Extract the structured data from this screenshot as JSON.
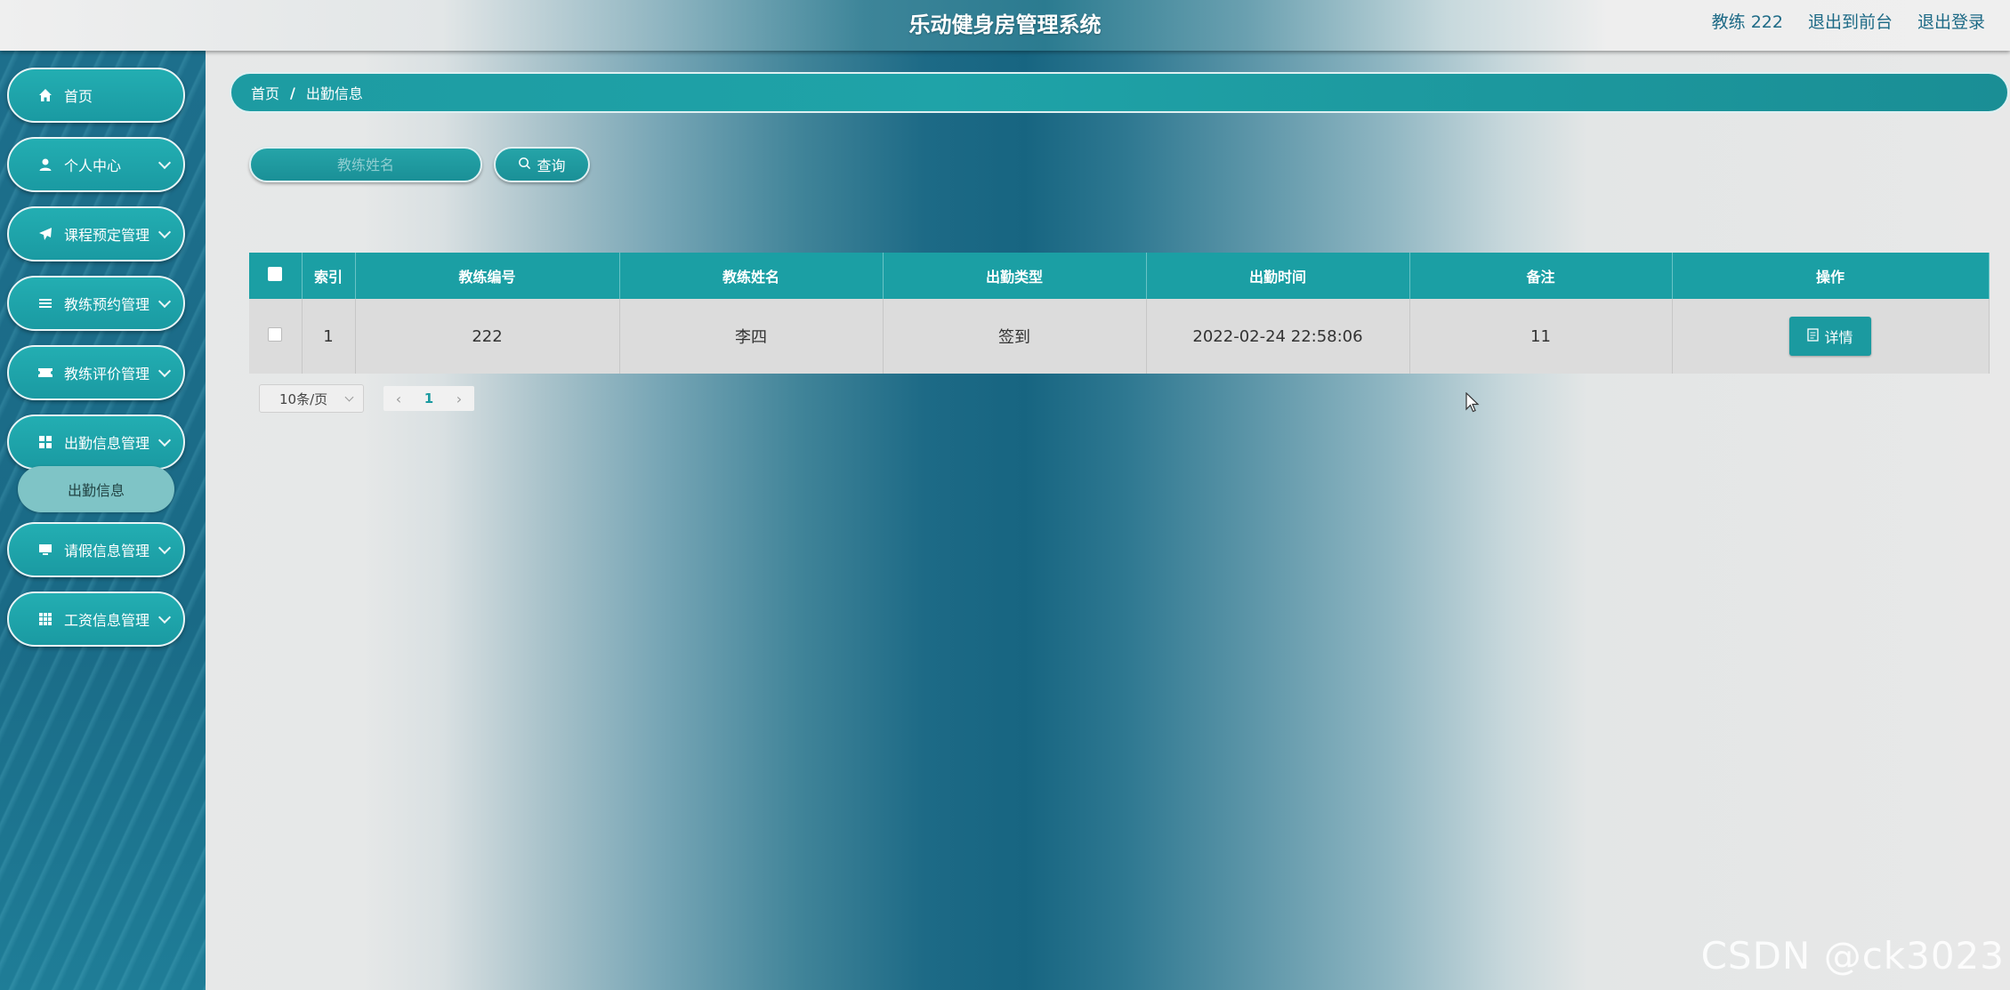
{
  "header": {
    "title": "乐动健身房管理系统",
    "user_label": "教练 222",
    "to_front_label": "退出到前台",
    "logout_label": "退出登录"
  },
  "sidebar": {
    "items": [
      {
        "label": "首页",
        "icon": "home-icon",
        "expandable": false
      },
      {
        "label": "个人中心",
        "icon": "user-icon",
        "expandable": true
      },
      {
        "label": "课程预定管理",
        "icon": "send-icon",
        "expandable": true
      },
      {
        "label": "教练预约管理",
        "icon": "list-icon",
        "expandable": true
      },
      {
        "label": "教练评价管理",
        "icon": "ticket-icon",
        "expandable": true
      },
      {
        "label": "出勤信息管理",
        "icon": "grid-icon",
        "expandable": true
      },
      {
        "label": "请假信息管理",
        "icon": "monitor-icon",
        "expandable": true
      },
      {
        "label": "工资信息管理",
        "icon": "apps-icon",
        "expandable": true
      }
    ],
    "active_sub_item": "出勤信息"
  },
  "breadcrumb": {
    "home": "首页",
    "separator": "/",
    "current": "出勤信息"
  },
  "search": {
    "placeholder": "教练姓名",
    "button_label": "查询"
  },
  "table": {
    "columns": [
      "索引",
      "教练编号",
      "教练姓名",
      "出勤类型",
      "出勤时间",
      "备注",
      "操作"
    ],
    "rows": [
      {
        "index": "1",
        "coach_id": "222",
        "coach_name": "李四",
        "type": "签到",
        "time": "2022-02-24 22:58:06",
        "remark": "11",
        "action": "详情"
      }
    ]
  },
  "pagination": {
    "page_size": "10条/页",
    "current_page": "1",
    "prev": "‹",
    "next": "›"
  },
  "watermark": "CSDN @ck3023",
  "colors": {
    "accent": "#1b9fa4",
    "sidebar": "#1a6a86"
  }
}
